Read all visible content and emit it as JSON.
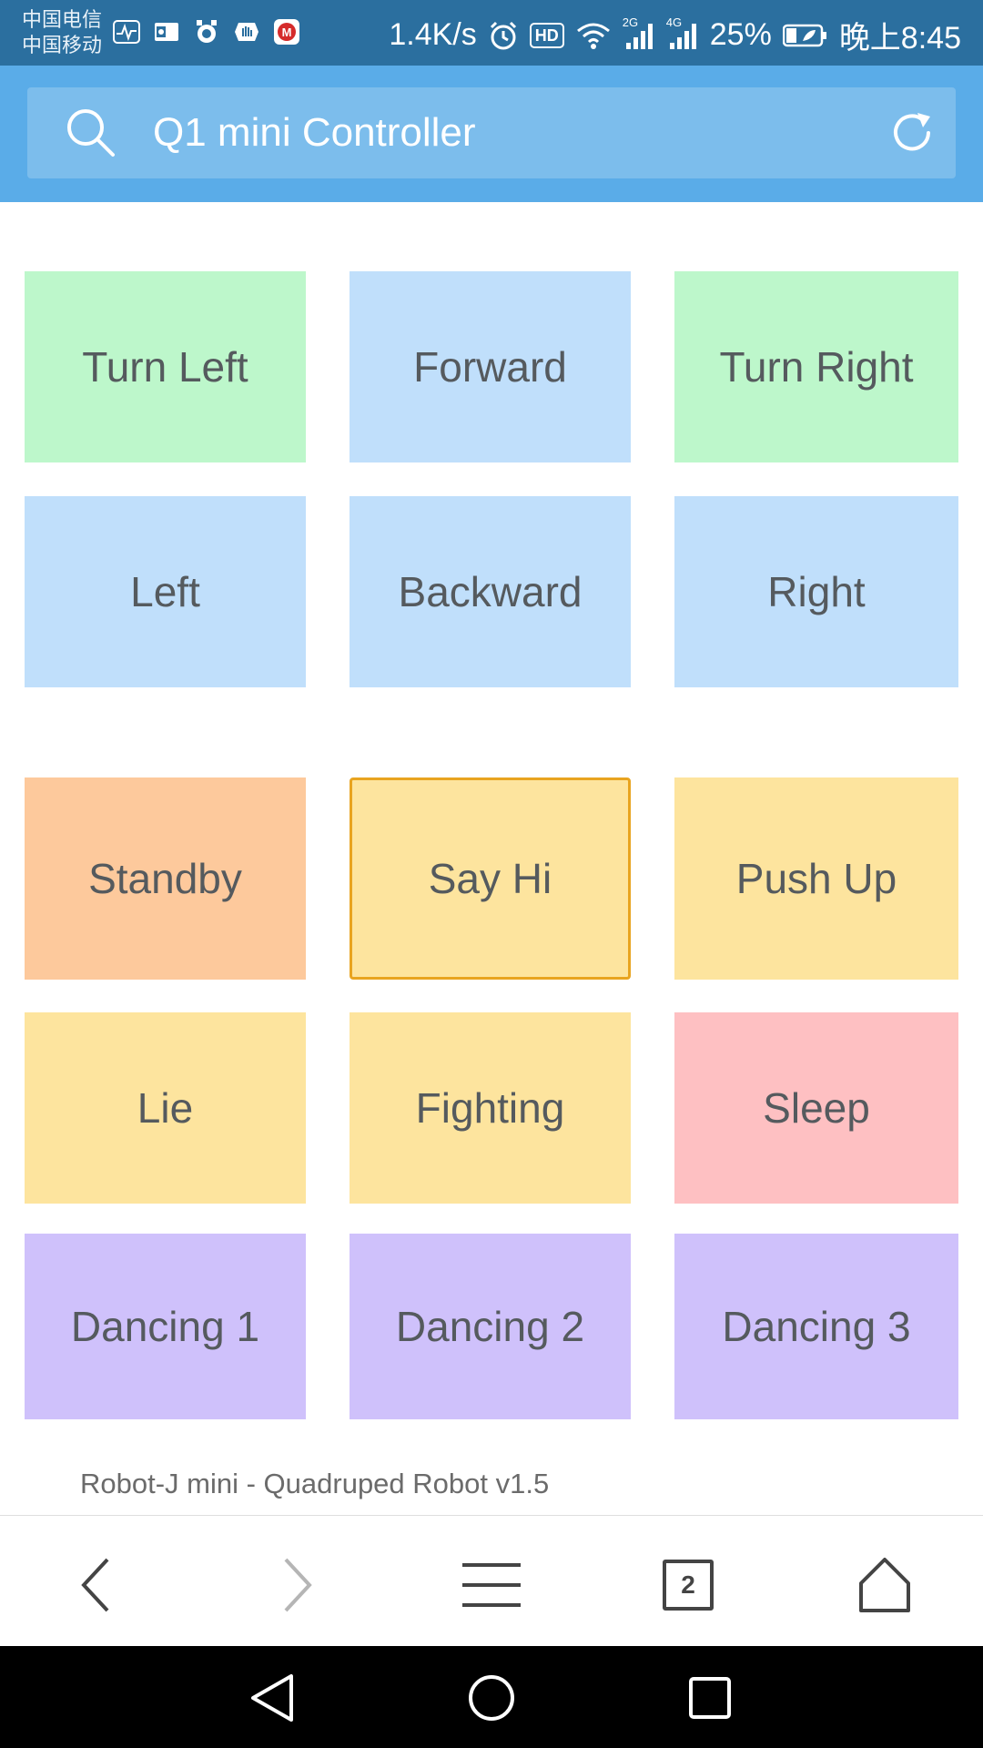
{
  "status_bar": {
    "carrier_1": "中国电信",
    "carrier_2": "中国移动",
    "net_speed": "1.4K/s",
    "hd_label": "HD",
    "sim1_label": "2G",
    "sim2_label": "4G",
    "battery_percent": "25%",
    "time": "晚上8:45",
    "icons": [
      "activity-icon",
      "outlook-icon",
      "alarm-app-icon",
      "hand-icon",
      "metro-icon",
      "alarm-clock-icon",
      "hd-icon",
      "wifi-icon",
      "signal-2g-icon",
      "signal-4g-icon",
      "battery-icon"
    ]
  },
  "header": {
    "title": "Q1 mini Controller",
    "search_icon": "search-icon",
    "reload_icon": "reload-icon",
    "bg_color": "#5aace8"
  },
  "controls": {
    "movement": [
      {
        "label": "Turn Left",
        "color": "#bdf7cb"
      },
      {
        "label": "Forward",
        "color": "#c0dffb"
      },
      {
        "label": "Turn Right",
        "color": "#bdf7cb"
      },
      {
        "label": "Left",
        "color": "#c0dffb"
      },
      {
        "label": "Backward",
        "color": "#c0dffb"
      },
      {
        "label": "Right",
        "color": "#c0dffb"
      }
    ],
    "actions": [
      {
        "label": "Standby",
        "color": "#fdc99c"
      },
      {
        "label": "Say Hi",
        "color": "#fde49e",
        "focused": true
      },
      {
        "label": "Push Up",
        "color": "#fde49e"
      },
      {
        "label": "Lie",
        "color": "#fde49e"
      },
      {
        "label": "Fighting",
        "color": "#fde49e"
      },
      {
        "label": "Sleep",
        "color": "#fec0c2"
      },
      {
        "label": "Dancing 1",
        "color": "#cfc1fb"
      },
      {
        "label": "Dancing 2",
        "color": "#cfc1fb"
      },
      {
        "label": "Dancing 3",
        "color": "#cfc1fb"
      }
    ]
  },
  "footer": {
    "version_text": "Robot-J mini - Quadruped Robot v1.5"
  },
  "browser_toolbar": {
    "tab_count": "2",
    "icons": [
      "back-icon",
      "forward-icon",
      "menu-icon",
      "tabs-icon",
      "home-icon"
    ]
  },
  "nav_bar": {
    "icons": [
      "nav-back-icon",
      "nav-home-icon",
      "nav-recents-icon"
    ]
  }
}
